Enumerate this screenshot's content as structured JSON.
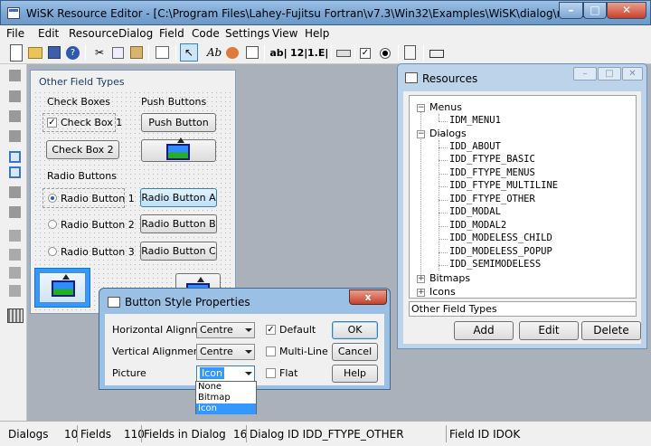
{
  "window": {
    "title": "WiSK Resource Editor - [C:\\Program Files\\Lahey-Fujitsu Fortran\\v7.3\\Win32\\Examples\\WiSK\\dialog\\resource.rc]",
    "minimize": "–",
    "maximize": "□",
    "close": "✕"
  },
  "menu": [
    "File",
    "Edit",
    "Resource",
    "Dialog",
    "Field",
    "Code",
    "Settings",
    "View",
    "Help"
  ],
  "toolbar": {
    "text_tool": "Ab",
    "ab_tool": "ab|",
    "num_tool": "12|",
    "real_tool": "1.E|",
    "icons": [
      "new-icon",
      "open-icon",
      "save-icon",
      "help-icon",
      "cut-icon",
      "copy-icon",
      "paste-icon",
      "properties-icon",
      "pointer-icon",
      "text-icon",
      "image-icon",
      "edit-icon"
    ]
  },
  "design_dialog": {
    "title": "Other Field Types",
    "check_boxes_label": "Check Boxes",
    "push_buttons_label": "Push Buttons",
    "check_box_1": "Check Box 1",
    "check_box_2": "Check Box 2",
    "push_button": "Push Button",
    "radio_buttons_label": "Radio Buttons",
    "radio_1": "Radio Button 1",
    "radio_2": "Radio Button 2",
    "radio_3": "Radio Button 3",
    "radio_a": "Radio Button A",
    "radio_b": "Radio Button B",
    "radio_c": "Radio Button C"
  },
  "resources": {
    "title": "Resources",
    "tree": {
      "menus": "Menus",
      "idm_menu1": "IDM_MENU1",
      "dialogs": "Dialogs",
      "dialog_items": [
        "IDD_ABOUT",
        "IDD_FTYPE_BASIC",
        "IDD_FTYPE_MENUS",
        "IDD_FTYPE_MULTILINE",
        "IDD_FTYPE_OTHER",
        "IDD_MODAL",
        "IDD_MODAL2",
        "IDD_MODELESS_CHILD",
        "IDD_MODELESS_POPUP",
        "IDD_SEMIMODELESS"
      ],
      "bitmaps": "Bitmaps",
      "icons": "Icons"
    },
    "selected_name": "Other Field Types",
    "add": "Add",
    "edit": "Edit",
    "delete": "Delete"
  },
  "button_style": {
    "title": "Button Style Properties",
    "close": "x",
    "horizontal_label": "Horizontal Alignment",
    "horizontal_value": "Centre",
    "vertical_label": "Vertical Alignment",
    "vertical_value": "Centre",
    "picture_label": "Picture",
    "picture_value": "Icon",
    "default_label": "Default",
    "default_checked": true,
    "multiline_label": "Multi-Line",
    "flat_label": "Flat",
    "ok": "OK",
    "cancel": "Cancel",
    "help": "Help",
    "picture_options": [
      "None",
      "Bitmap",
      "Icon"
    ],
    "picture_selected": "Icon"
  },
  "status": {
    "dialogs_label": "Dialogs",
    "dialogs_count": "10",
    "fields_label": "Fields",
    "fields_count": "110",
    "fields_in_dialog_label": "Fields in Dialog",
    "fields_in_dialog_count": "16",
    "dialog_id": "Dialog ID  IDD_FTYPE_OTHER",
    "field_id": "Field ID  IDOK"
  }
}
